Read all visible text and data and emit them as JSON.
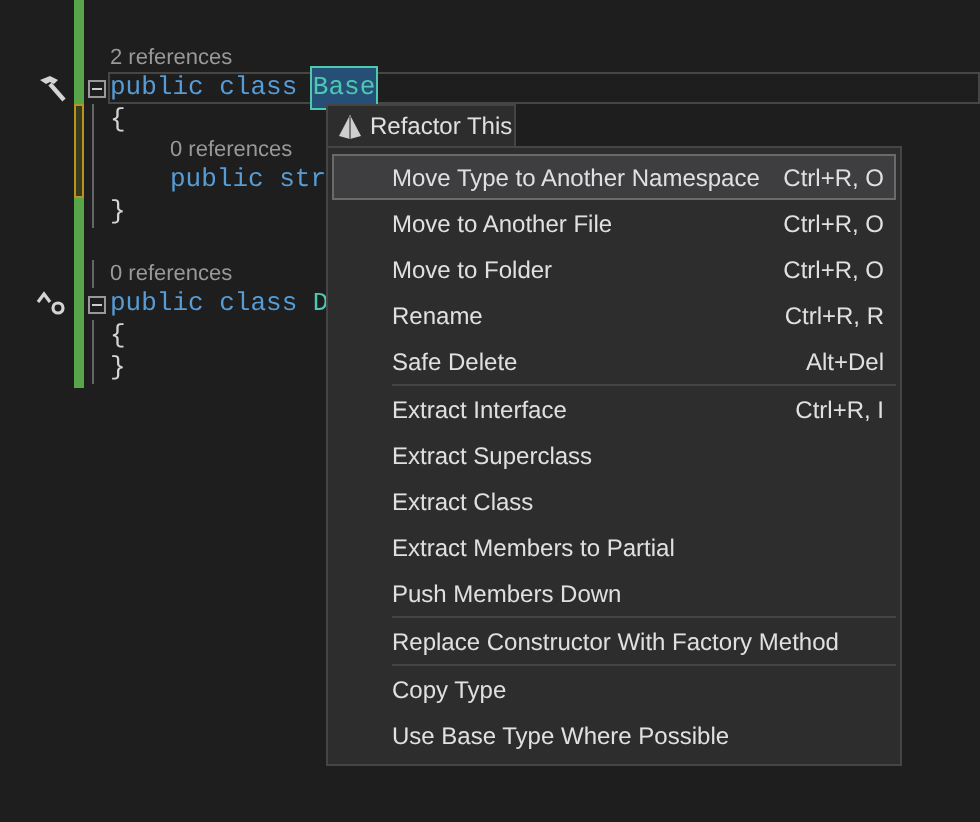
{
  "editor": {
    "lines": [
      {
        "kind": "codelens",
        "text": "2 references"
      },
      {
        "kind": "code",
        "gutter": {
          "kind": "hammer"
        },
        "foldable": true,
        "current": true,
        "tokens": [
          {
            "text": "public",
            "kind": "keyword"
          },
          {
            "text": "class",
            "kind": "keyword"
          },
          {
            "text": "Base",
            "kind": "type",
            "selected": true
          }
        ]
      },
      {
        "kind": "code",
        "tokens": [
          {
            "text": "{",
            "kind": "punct"
          }
        ]
      },
      {
        "kind": "codelens_nested",
        "text": "0 references"
      },
      {
        "kind": "code_nested",
        "tokens": [
          {
            "text": "public",
            "kind": "keyword"
          },
          {
            "text": "str",
            "kind": "keyword"
          }
        ]
      },
      {
        "kind": "code",
        "tokens": [
          {
            "text": "}",
            "kind": "punct"
          }
        ]
      },
      {
        "kind": "blank"
      },
      {
        "kind": "codelens",
        "text": "0 references"
      },
      {
        "kind": "code",
        "gutter": {
          "kind": "inheritance"
        },
        "foldable": true,
        "tokens": [
          {
            "text": "public",
            "kind": "keyword"
          },
          {
            "text": "class",
            "kind": "keyword"
          },
          {
            "text": "D",
            "kind": "type",
            "selected": false
          }
        ]
      },
      {
        "kind": "code",
        "tokens": [
          {
            "text": "{",
            "kind": "punct"
          }
        ]
      },
      {
        "kind": "code",
        "tokens": [
          {
            "text": "}",
            "kind": "punct"
          }
        ]
      }
    ]
  },
  "menu": {
    "title": "Refactor This",
    "groups": [
      [
        {
          "label": "Move Type to Another Namespace",
          "shortcut": "Ctrl+R, O",
          "selected": true
        },
        {
          "label": "Move to Another File",
          "shortcut": "Ctrl+R, O",
          "selected": false
        },
        {
          "label": "Move to Folder",
          "shortcut": "Ctrl+R, O",
          "selected": false
        },
        {
          "label": "Rename",
          "shortcut": "Ctrl+R, R",
          "selected": false
        },
        {
          "label": "Safe Delete",
          "shortcut": "Alt+Del",
          "selected": false
        }
      ],
      [
        {
          "label": "Extract Interface",
          "shortcut": "Ctrl+R, I",
          "selected": false
        },
        {
          "label": "Extract Superclass",
          "selected": false
        },
        {
          "label": "Extract Class",
          "selected": false
        },
        {
          "label": "Extract Members to Partial",
          "selected": false
        },
        {
          "label": "Push Members Down",
          "selected": false
        }
      ],
      [
        {
          "label": "Replace Constructor With Factory Method",
          "selected": false
        }
      ],
      [
        {
          "label": "Copy Type",
          "selected": false
        },
        {
          "label": "Use Base Type Where Possible",
          "selected": false
        }
      ]
    ]
  }
}
